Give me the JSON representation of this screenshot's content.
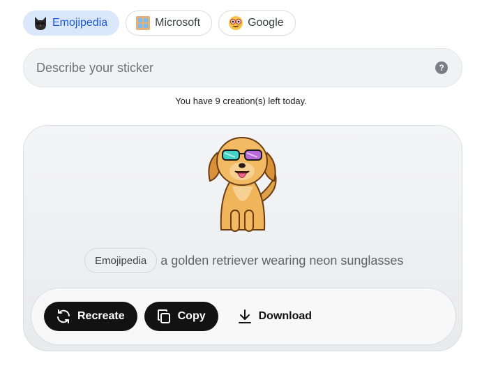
{
  "vendors": [
    {
      "label": "Emojipedia",
      "icon": "black-cat-icon",
      "active": true
    },
    {
      "label": "Microsoft",
      "icon": "window-icon",
      "active": false
    },
    {
      "label": "Google",
      "icon": "nerd-face-icon",
      "active": false
    }
  ],
  "search": {
    "placeholder": "Describe your sticker",
    "value": ""
  },
  "quota_text": "You have 9 creation(s) left today.",
  "result": {
    "vendor_tag": "Emojipedia",
    "prompt": "a golden retriever wearing neon sunglasses",
    "sticker_icon": "golden-retriever-sunglasses-sticker"
  },
  "actions": {
    "recreate": "Recreate",
    "copy": "Copy",
    "download": "Download"
  },
  "colors": {
    "accent": "#1a5ad7",
    "active_pill_bg": "#dbe8fb",
    "dark_button": "#121212"
  }
}
